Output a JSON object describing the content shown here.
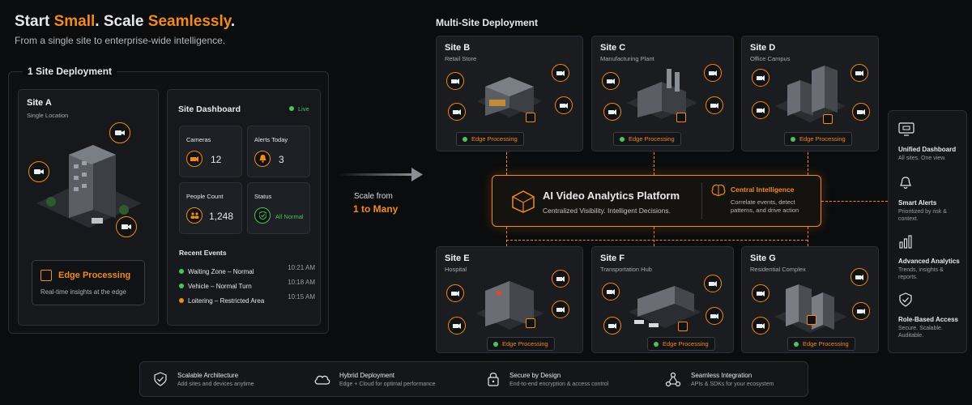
{
  "header": {
    "title_prefix": "Start ",
    "title_word1": "Small",
    "title_mid": ". Scale ",
    "title_word2": "Seamlessly",
    "title_suffix": ".",
    "subtitle": "From a single site to enterprise-wide intelligence."
  },
  "single": {
    "section_title": "1 Site Deployment",
    "site_name": "Site A",
    "site_sub": "Single Location",
    "edge_title": "Edge Processing",
    "edge_sub": "Real-time insights at the edge"
  },
  "dashboard": {
    "title": "Site Dashboard",
    "live": "Live",
    "cameras_label": "Cameras",
    "cameras_value": "12",
    "alerts_label": "Alerts Today",
    "alerts_value": "3",
    "people_label": "People Count",
    "people_value": "1,248",
    "status_label": "Status",
    "status_value": "All Normal",
    "events_title": "Recent Events",
    "events": [
      {
        "text": "Waiting Zone – Normal",
        "time": "10:21 AM",
        "color": "#4cc35a"
      },
      {
        "text": "Vehicle – Normal Turn",
        "time": "10:18 AM",
        "color": "#4cc35a"
      },
      {
        "text": "Loitering – Restricted Area",
        "time": "10:15 AM",
        "color": "#f28a1c"
      }
    ]
  },
  "scale": {
    "line1": "Scale from",
    "line2": "1 to Many"
  },
  "multi": {
    "section_title": "Multi-Site Deployment",
    "edge_label": "Edge Processing",
    "sites": [
      {
        "name": "Site B",
        "sub": "Retail Store"
      },
      {
        "name": "Site C",
        "sub": "Manufacturing Plant"
      },
      {
        "name": "Site D",
        "sub": "Office Campus"
      },
      {
        "name": "Site E",
        "sub": "Hospital"
      },
      {
        "name": "Site F",
        "sub": "Transportation Hub"
      },
      {
        "name": "Site G",
        "sub": "Residential Complex"
      }
    ]
  },
  "platform": {
    "title": "AI Video Analytics Platform",
    "sub": "Centralized Visibility. Intelligent Decisions.",
    "ci_title": "Central Intelligence",
    "ci_sub": "Correlate events, detect patterns, and drive action"
  },
  "right_features": [
    {
      "title": "Unified Dashboard",
      "sub": "All sites. One view.",
      "icon": "monitor-icon"
    },
    {
      "title": "Smart Alerts",
      "sub": "Prioritized by risk & context.",
      "icon": "bell-icon"
    },
    {
      "title": "Advanced Analytics",
      "sub": "Trends, insights & reports.",
      "icon": "bar-chart-icon"
    },
    {
      "title": "Role-Based Access",
      "sub": "Secure. Scalable. Auditable.",
      "icon": "shield-check-icon"
    }
  ],
  "bottom_features": [
    {
      "title": "Scalable Architecture",
      "sub": "Add sites and devices anytime",
      "icon": "shield-check-icon"
    },
    {
      "title": "Hybrid Deployment",
      "sub": "Edge + Cloud for optimal performance",
      "icon": "cloud-icon"
    },
    {
      "title": "Secure by Design",
      "sub": "End-to-end encryption & access control",
      "icon": "lock-icon"
    },
    {
      "title": "Seamless Integration",
      "sub": "APIs & SDKs for your ecosystem",
      "icon": "network-icon"
    }
  ],
  "colors": {
    "accent": "#f28a1c",
    "live": "#4cc35a",
    "background": "#0b0c0e"
  }
}
